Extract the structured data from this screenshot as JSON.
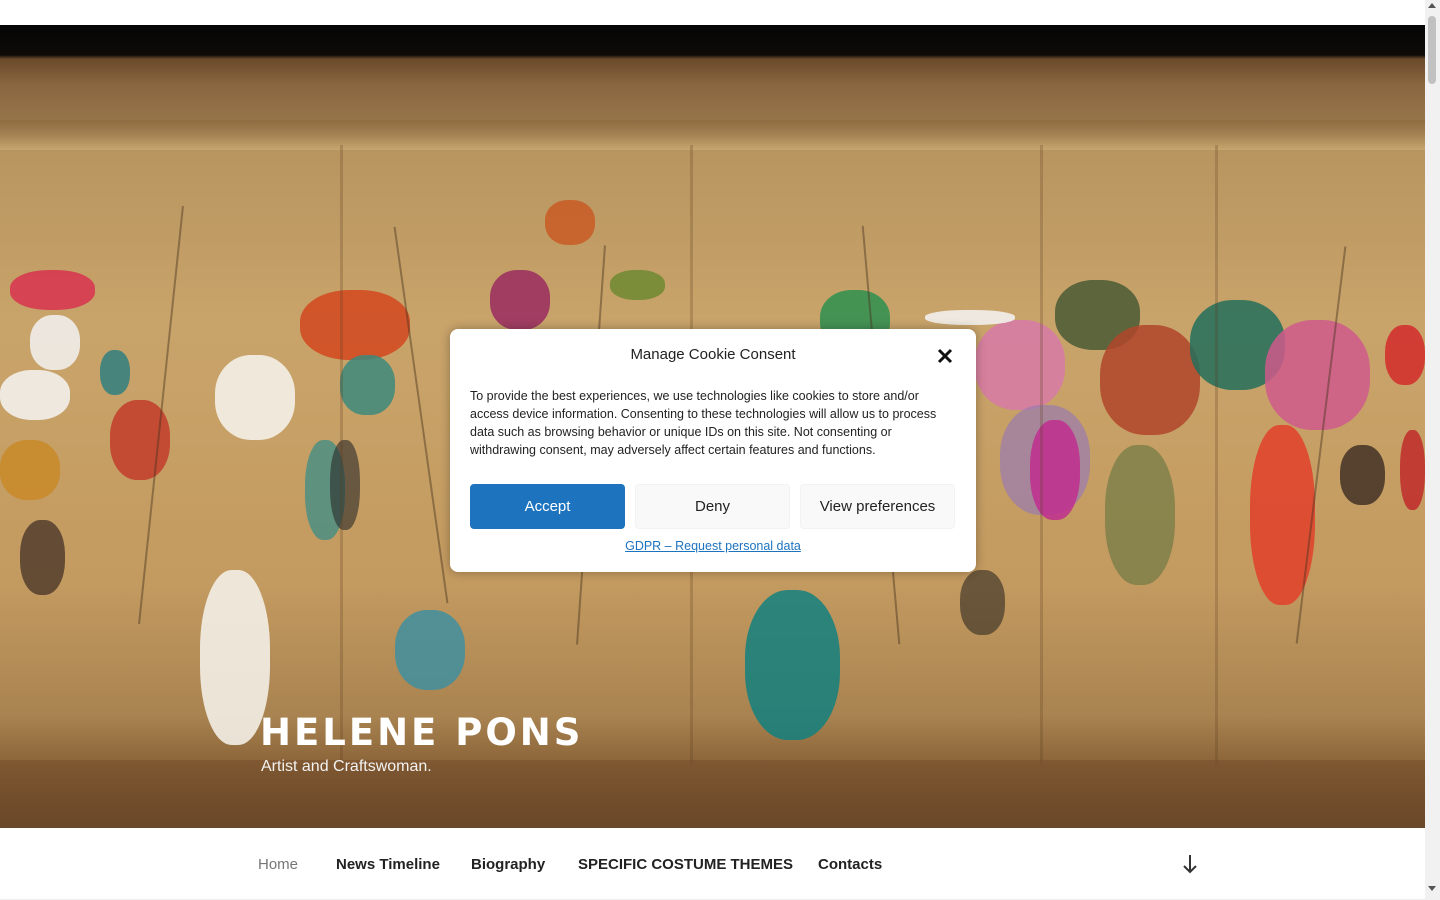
{
  "site": {
    "title": "HELENE PONS",
    "tagline": "Artist and Craftswoman."
  },
  "nav": {
    "items": [
      {
        "label": "Home",
        "current": true
      },
      {
        "label": "News Timeline"
      },
      {
        "label": "Biography"
      },
      {
        "label": "SPECIFIC COSTUME THEMES"
      },
      {
        "label": "Contacts"
      }
    ],
    "scroll_icon": "arrow-down-icon"
  },
  "cookie_modal": {
    "title": "Manage Cookie Consent",
    "body": "To provide the best experiences, we use technologies like cookies to store and/or access device information. Consenting to these technologies will allow us to process data such as browsing behavior or unique IDs on this site. Not consenting or withdrawing consent, may adversely affect certain features and functions.",
    "accept_label": "Accept",
    "deny_label": "Deny",
    "preferences_label": "View preferences",
    "link_label": "GDPR – Request personal data",
    "close_icon": "close-icon"
  },
  "colors": {
    "accent": "#1e73be",
    "nav_current": "#767676",
    "text": "#222222"
  }
}
